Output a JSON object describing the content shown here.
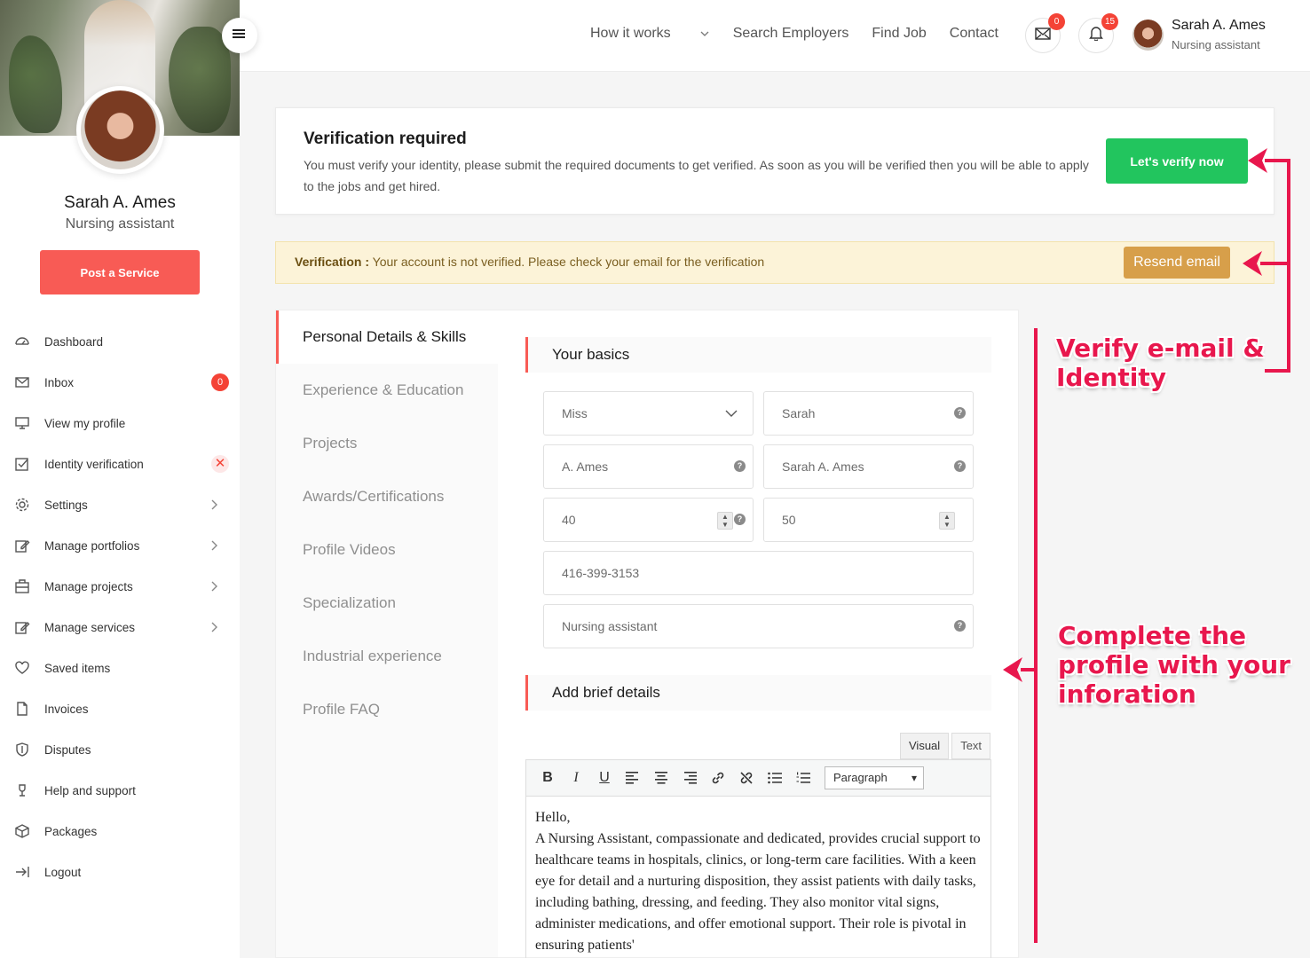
{
  "sidebar": {
    "profile_name": "Sarah A. Ames",
    "profile_role": "Nursing assistant",
    "post_button": "Post a Service",
    "items": [
      {
        "label": "Dashboard",
        "icon": "dashboard-icon"
      },
      {
        "label": "Inbox",
        "icon": "mail-icon",
        "badge": "0"
      },
      {
        "label": "View my profile",
        "icon": "monitor-icon"
      },
      {
        "label": "Identity verification",
        "icon": "check-square-icon",
        "status": "✕"
      },
      {
        "label": "Settings",
        "icon": "gear-icon"
      },
      {
        "label": "Manage portfolios",
        "icon": "edit-icon"
      },
      {
        "label": "Manage projects",
        "icon": "briefcase-icon"
      },
      {
        "label": "Manage services",
        "icon": "edit-icon"
      },
      {
        "label": "Saved items",
        "icon": "heart-icon"
      },
      {
        "label": "Invoices",
        "icon": "file-icon"
      },
      {
        "label": "Disputes",
        "icon": "shield-icon"
      },
      {
        "label": "Help and support",
        "icon": "help-icon"
      },
      {
        "label": "Packages",
        "icon": "package-icon"
      },
      {
        "label": "Logout",
        "icon": "logout-icon"
      }
    ]
  },
  "header": {
    "nav": [
      "How it works",
      "Search Employers",
      "Find Job",
      "Contact"
    ],
    "mail_badge": "0",
    "notif_badge": "15",
    "user_name": "Sarah A. Ames",
    "user_role": "Nursing assistant"
  },
  "verification": {
    "title": "Verification required",
    "text": "You must verify your identity, please submit the required documents to get verified. As soon as you will be verified then you will be able to apply to the jobs and get hired.",
    "button": "Let's verify now"
  },
  "alert": {
    "label": "Verification :",
    "text": "Your account is not verified. Please check your email for the verification",
    "button": "Resend email"
  },
  "profile_tabs": [
    "Personal Details & Skills",
    "Experience & Education",
    "Projects",
    "Awards/Certifications",
    "Profile Videos",
    "Specialization",
    "Industrial experience",
    "Profile FAQ"
  ],
  "basics": {
    "title": "Your basics",
    "salutation": "Miss",
    "first_name": "Sarah",
    "last_name": "A. Ames",
    "display_name": "Sarah A. Ames",
    "number_a": "40",
    "number_b": "50",
    "phone": "416-399-3153",
    "tagline": "Nursing assistant"
  },
  "brief": {
    "title": "Add brief details",
    "tab_visual": "Visual",
    "tab_text": "Text",
    "format_select": "Paragraph",
    "line1": "Hello,",
    "body": "A Nursing Assistant, compassionate and dedicated, provides crucial support to healthcare teams in hospitals, clinics, or long-term care facilities. With a keen eye for detail and a nurturing disposition, they assist patients with daily tasks, including bathing, dressing, and feeding. They also monitor vital signs, administer medications, and offer emotional support. Their role is pivotal in ensuring patients'"
  },
  "annotations": {
    "verify": "Verify e-mail & Identity",
    "complete": "Complete the profile with your inforation"
  },
  "colors": {
    "accent_red": "#f85b55",
    "verify_green": "#22c55e",
    "resend_gold": "#d79f4a",
    "annotation_pink": "#e8174d"
  }
}
